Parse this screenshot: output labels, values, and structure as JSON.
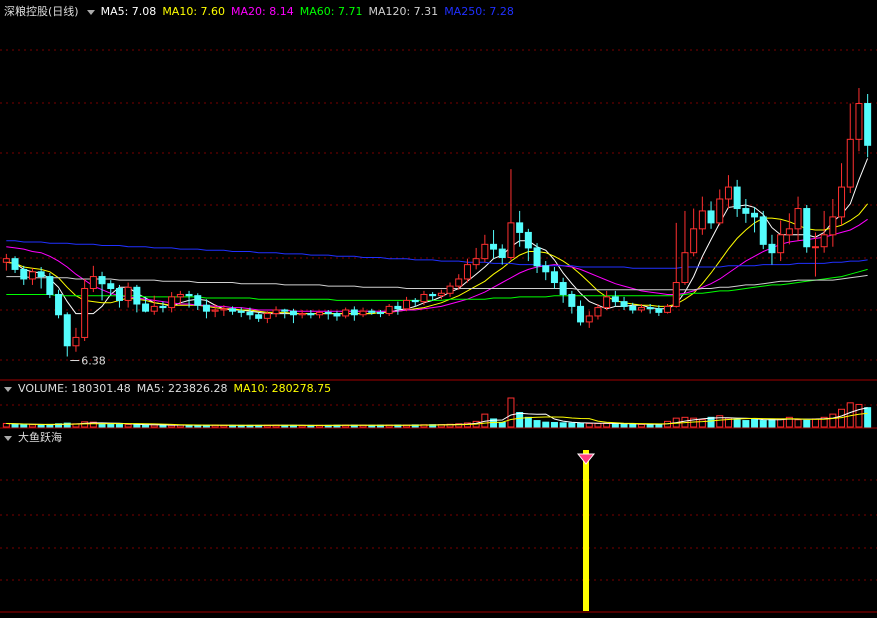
{
  "main_legend": {
    "title": "深粮控股(日线)",
    "items": [
      {
        "label": "MA5: 7.08",
        "color": "#ffffff"
      },
      {
        "label": "MA10: 7.60",
        "color": "#ffff00"
      },
      {
        "label": "MA20: 8.14",
        "color": "#ff00ff"
      },
      {
        "label": "MA60: 7.71",
        "color": "#00ff00"
      },
      {
        "label": "MA120: 7.31",
        "color": "#d0d0d0"
      },
      {
        "label": "MA250: 7.28",
        "color": "#2030ff"
      }
    ]
  },
  "volume_legend": {
    "items": [
      {
        "label": "VOLUME: 180301.48",
        "color": "#dddddd"
      },
      {
        "label": "MA5: 223826.28",
        "color": "#dddddd"
      },
      {
        "label": "MA10: 280278.75",
        "color": "#ffff00"
      }
    ]
  },
  "indicator_legend": {
    "title": "大鱼跃海"
  },
  "min_price_label": "6.38",
  "colors": {
    "up": "#ff3030",
    "down": "#54fcfc",
    "grid": "#7a0000",
    "signal": "#ffff00"
  },
  "chart_data": {
    "type": "candlestick",
    "min_price": 6.38,
    "candles": [
      [
        7.17,
        7.2,
        7.1,
        7.24
      ],
      [
        7.2,
        7.11,
        7.08,
        7.22
      ],
      [
        7.11,
        7.03,
        6.98,
        7.14
      ],
      [
        7.03,
        7.09,
        6.98,
        7.12
      ],
      [
        7.09,
        7.05,
        6.95,
        7.13
      ],
      [
        7.05,
        6.9,
        6.87,
        7.08
      ],
      [
        6.9,
        6.73,
        6.7,
        6.94
      ],
      [
        6.73,
        6.47,
        6.38,
        6.75
      ],
      [
        6.47,
        6.54,
        6.42,
        6.62
      ],
      [
        6.54,
        6.95,
        6.51,
        7.03
      ],
      [
        6.95,
        7.05,
        6.92,
        7.14
      ],
      [
        7.05,
        6.99,
        6.85,
        7.09
      ],
      [
        6.99,
        6.95,
        6.89,
        7.02
      ],
      [
        6.95,
        6.85,
        6.79,
        6.98
      ],
      [
        6.85,
        6.96,
        6.79,
        7.0
      ],
      [
        6.96,
        6.82,
        6.75,
        6.98
      ],
      [
        6.82,
        6.76,
        6.75,
        6.88
      ],
      [
        6.76,
        6.8,
        6.73,
        6.89
      ],
      [
        6.8,
        6.79,
        6.75,
        6.84
      ],
      [
        6.79,
        6.88,
        6.75,
        6.92
      ],
      [
        6.88,
        6.9,
        6.82,
        6.93
      ],
      [
        6.9,
        6.89,
        6.79,
        6.93
      ],
      [
        6.89,
        6.81,
        6.77,
        6.91
      ],
      [
        6.81,
        6.76,
        6.7,
        6.86
      ],
      [
        6.76,
        6.77,
        6.71,
        6.82
      ],
      [
        6.77,
        6.78,
        6.72,
        6.81
      ],
      [
        6.78,
        6.76,
        6.73,
        6.8
      ],
      [
        6.76,
        6.75,
        6.71,
        6.79
      ],
      [
        6.75,
        6.73,
        6.69,
        6.79
      ],
      [
        6.73,
        6.7,
        6.67,
        6.75
      ],
      [
        6.7,
        6.74,
        6.66,
        6.76
      ],
      [
        6.74,
        6.77,
        6.71,
        6.8
      ],
      [
        6.77,
        6.76,
        6.7,
        6.78
      ],
      [
        6.76,
        6.73,
        6.66,
        6.78
      ],
      [
        6.73,
        6.74,
        6.7,
        6.77
      ],
      [
        6.74,
        6.73,
        6.7,
        6.77
      ],
      [
        6.73,
        6.75,
        6.7,
        6.76
      ],
      [
        6.75,
        6.74,
        6.69,
        6.77
      ],
      [
        6.74,
        6.72,
        6.68,
        6.76
      ],
      [
        6.72,
        6.77,
        6.7,
        6.79
      ],
      [
        6.77,
        6.73,
        6.68,
        6.8
      ],
      [
        6.73,
        6.76,
        6.71,
        6.79
      ],
      [
        6.76,
        6.75,
        6.73,
        6.78
      ],
      [
        6.75,
        6.74,
        6.71,
        6.77
      ],
      [
        6.74,
        6.8,
        6.72,
        6.82
      ],
      [
        6.8,
        6.78,
        6.73,
        6.84
      ],
      [
        6.78,
        6.85,
        6.76,
        6.88
      ],
      [
        6.85,
        6.84,
        6.8,
        6.87
      ],
      [
        6.84,
        6.9,
        6.81,
        6.93
      ],
      [
        6.9,
        6.89,
        6.85,
        6.92
      ],
      [
        6.89,
        6.91,
        6.86,
        6.94
      ],
      [
        6.91,
        6.97,
        6.88,
        7.0
      ],
      [
        6.97,
        7.03,
        6.94,
        7.07
      ],
      [
        7.03,
        7.15,
        7.0,
        7.2
      ],
      [
        7.15,
        7.2,
        7.11,
        7.29
      ],
      [
        7.2,
        7.32,
        7.17,
        7.4
      ],
      [
        7.32,
        7.28,
        7.2,
        7.44
      ],
      [
        7.28,
        7.21,
        7.15,
        7.32
      ],
      [
        7.21,
        7.5,
        7.19,
        7.95
      ],
      [
        7.5,
        7.42,
        7.3,
        7.6
      ],
      [
        7.42,
        7.29,
        7.18,
        7.45
      ],
      [
        7.29,
        7.14,
        7.08,
        7.33
      ],
      [
        7.14,
        7.09,
        7.02,
        7.18
      ],
      [
        7.09,
        7.0,
        6.95,
        7.13
      ],
      [
        7.0,
        6.9,
        6.83,
        7.04
      ],
      [
        6.9,
        6.8,
        6.74,
        6.93
      ],
      [
        6.8,
        6.67,
        6.64,
        6.85
      ],
      [
        6.67,
        6.72,
        6.62,
        6.76
      ],
      [
        6.72,
        6.79,
        6.69,
        6.82
      ],
      [
        6.79,
        6.88,
        6.77,
        6.93
      ],
      [
        6.88,
        6.84,
        6.8,
        6.93
      ],
      [
        6.84,
        6.8,
        6.77,
        6.88
      ],
      [
        6.8,
        6.77,
        6.74,
        6.83
      ],
      [
        6.77,
        6.79,
        6.75,
        6.82
      ],
      [
        6.79,
        6.78,
        6.74,
        6.82
      ],
      [
        6.78,
        6.75,
        6.72,
        6.81
      ],
      [
        6.75,
        6.8,
        6.74,
        6.82
      ],
      [
        6.8,
        7.0,
        6.79,
        7.5
      ],
      [
        7.0,
        7.25,
        6.98,
        7.6
      ],
      [
        7.25,
        7.45,
        7.22,
        7.62
      ],
      [
        7.45,
        7.6,
        7.4,
        7.72
      ],
      [
        7.6,
        7.5,
        7.45,
        7.68
      ],
      [
        7.5,
        7.7,
        7.48,
        7.78
      ],
      [
        7.7,
        7.8,
        7.62,
        7.9
      ],
      [
        7.8,
        7.62,
        7.55,
        7.86
      ],
      [
        7.62,
        7.58,
        7.5,
        7.7
      ],
      [
        7.58,
        7.55,
        7.42,
        7.63
      ],
      [
        7.55,
        7.32,
        7.28,
        7.6
      ],
      [
        7.32,
        7.25,
        7.15,
        7.4
      ],
      [
        7.25,
        7.4,
        7.18,
        7.52
      ],
      [
        7.4,
        7.45,
        7.32,
        7.58
      ],
      [
        7.45,
        7.62,
        7.35,
        7.72
      ],
      [
        7.62,
        7.3,
        7.25,
        7.65
      ],
      [
        7.3,
        7.3,
        7.05,
        7.42
      ],
      [
        7.3,
        7.4,
        7.25,
        7.6
      ],
      [
        7.4,
        7.55,
        7.3,
        7.7
      ],
      [
        7.55,
        7.8,
        7.48,
        8.0
      ],
      [
        7.8,
        8.2,
        7.75,
        8.5
      ],
      [
        8.2,
        8.5,
        8.1,
        8.63
      ],
      [
        8.5,
        8.15,
        8.05,
        8.58
      ]
    ],
    "ma": [
      {
        "name": "MA5",
        "values": [
          7.17,
          7.16,
          7.11,
          7.09,
          7.08,
          7.03,
          6.96,
          6.84,
          6.74,
          6.74,
          6.74,
          6.8,
          6.9,
          6.96,
          6.96,
          6.91,
          6.87,
          6.83,
          6.82,
          6.8,
          6.83,
          6.85,
          6.86,
          6.85,
          6.81,
          6.78,
          6.77,
          6.77,
          6.76,
          6.75,
          6.74,
          6.74,
          6.74,
          6.74,
          6.74,
          6.74,
          6.74,
          6.74,
          6.74,
          6.74,
          6.74,
          6.74,
          6.74,
          6.75,
          6.75,
          6.77,
          6.78,
          6.8,
          6.83,
          6.85,
          6.88,
          6.92,
          6.95,
          7.01,
          7.07,
          7.13,
          7.2,
          7.23,
          7.3,
          7.35,
          7.35,
          7.3,
          7.27,
          7.19,
          7.08,
          6.99,
          6.91,
          6.84,
          6.81,
          6.78,
          6.8,
          6.8,
          6.81,
          6.81,
          6.79,
          6.78,
          6.78,
          6.82,
          6.92,
          7.05,
          7.22,
          7.36,
          7.5,
          7.63,
          7.64,
          7.65,
          7.63,
          7.57,
          7.46,
          7.4,
          7.4,
          7.4,
          7.4,
          7.38,
          7.42,
          7.51,
          7.57,
          7.66,
          7.86,
          8.04
        ]
      },
      {
        "name": "MA10",
        "values": [
          7.17,
          7.16,
          7.13,
          7.12,
          7.11,
          7.09,
          7.04,
          6.96,
          6.89,
          6.85,
          6.84,
          6.83,
          6.83,
          6.85,
          6.87,
          6.86,
          6.85,
          6.83,
          6.82,
          6.81,
          6.81,
          6.81,
          6.81,
          6.8,
          6.79,
          6.78,
          6.78,
          6.77,
          6.77,
          6.76,
          6.75,
          6.75,
          6.75,
          6.74,
          6.74,
          6.74,
          6.74,
          6.74,
          6.74,
          6.74,
          6.74,
          6.74,
          6.74,
          6.75,
          6.75,
          6.76,
          6.77,
          6.78,
          6.79,
          6.81,
          6.83,
          6.86,
          6.89,
          6.93,
          6.97,
          7.01,
          7.07,
          7.12,
          7.18,
          7.23,
          7.26,
          7.26,
          7.25,
          7.22,
          7.18,
          7.13,
          7.07,
          7.0,
          6.93,
          6.88,
          6.85,
          6.83,
          6.82,
          6.81,
          6.81,
          6.8,
          6.8,
          6.82,
          6.86,
          6.91,
          6.99,
          7.08,
          7.18,
          7.28,
          7.37,
          7.44,
          7.5,
          7.54,
          7.54,
          7.53,
          7.51,
          7.48,
          7.45,
          7.44,
          7.44,
          7.46,
          7.48,
          7.52,
          7.57,
          7.66
        ]
      },
      {
        "name": "MA20",
        "values": [
          7.3,
          7.29,
          7.28,
          7.26,
          7.25,
          7.22,
          7.18,
          7.13,
          7.07,
          7.02,
          6.97,
          6.94,
          6.91,
          6.89,
          6.88,
          6.87,
          6.86,
          6.85,
          6.84,
          6.83,
          6.82,
          6.82,
          6.81,
          6.81,
          6.8,
          6.8,
          6.79,
          6.79,
          6.78,
          6.77,
          6.77,
          6.77,
          6.77,
          6.76,
          6.76,
          6.76,
          6.76,
          6.76,
          6.76,
          6.76,
          6.76,
          6.76,
          6.76,
          6.76,
          6.76,
          6.76,
          6.77,
          6.77,
          6.78,
          6.79,
          6.8,
          6.82,
          6.84,
          6.86,
          6.89,
          6.92,
          6.96,
          7.0,
          7.04,
          7.08,
          7.11,
          7.13,
          7.14,
          7.15,
          7.14,
          7.13,
          7.11,
          7.08,
          7.05,
          7.02,
          6.99,
          6.97,
          6.95,
          6.93,
          6.92,
          6.91,
          6.9,
          6.9,
          6.91,
          6.93,
          6.96,
          6.99,
          7.03,
          7.08,
          7.13,
          7.18,
          7.22,
          7.26,
          7.29,
          7.32,
          7.34,
          7.35,
          7.36,
          7.37,
          7.38,
          7.4,
          7.42,
          7.44,
          7.48,
          7.53
        ]
      },
      {
        "name": "MA60",
        "values": [
          6.9,
          6.9,
          6.9,
          6.9,
          6.9,
          6.9,
          6.89,
          6.89,
          6.89,
          6.89,
          6.89,
          6.89,
          6.89,
          6.89,
          6.89,
          6.89,
          6.88,
          6.88,
          6.88,
          6.88,
          6.88,
          6.88,
          6.88,
          6.87,
          6.87,
          6.87,
          6.87,
          6.87,
          6.87,
          6.86,
          6.86,
          6.86,
          6.86,
          6.86,
          6.86,
          6.86,
          6.86,
          6.86,
          6.85,
          6.85,
          6.85,
          6.85,
          6.85,
          6.85,
          6.85,
          6.85,
          6.85,
          6.85,
          6.85,
          6.85,
          6.85,
          6.86,
          6.86,
          6.86,
          6.86,
          6.86,
          6.87,
          6.87,
          6.87,
          6.88,
          6.88,
          6.88,
          6.88,
          6.89,
          6.89,
          6.89,
          6.89,
          6.89,
          6.89,
          6.89,
          6.89,
          6.89,
          6.89,
          6.89,
          6.89,
          6.89,
          6.89,
          6.89,
          6.9,
          6.91,
          6.91,
          6.92,
          6.93,
          6.93,
          6.94,
          6.95,
          6.96,
          6.97,
          6.98,
          6.98,
          6.99,
          7.0,
          7.01,
          7.02,
          7.03,
          7.04,
          7.05,
          7.07,
          7.09,
          7.11
        ]
      },
      {
        "name": "MA120",
        "values": [
          7.05,
          7.05,
          7.05,
          7.04,
          7.04,
          7.04,
          7.04,
          7.04,
          7.03,
          7.03,
          7.03,
          7.03,
          7.03,
          7.02,
          7.02,
          7.02,
          7.02,
          7.02,
          7.01,
          7.01,
          7.01,
          7.01,
          7.0,
          7.0,
          7.0,
          7.0,
          7.0,
          6.99,
          6.99,
          6.99,
          6.99,
          6.99,
          6.98,
          6.98,
          6.98,
          6.98,
          6.98,
          6.97,
          6.97,
          6.97,
          6.97,
          6.96,
          6.96,
          6.96,
          6.96,
          6.96,
          6.95,
          6.95,
          6.95,
          6.95,
          6.95,
          6.95,
          6.95,
          6.95,
          6.95,
          6.95,
          6.95,
          6.95,
          6.95,
          6.95,
          6.95,
          6.95,
          6.95,
          6.95,
          6.95,
          6.95,
          6.94,
          6.94,
          6.94,
          6.94,
          6.94,
          6.94,
          6.94,
          6.94,
          6.94,
          6.94,
          6.94,
          6.94,
          6.94,
          6.94,
          6.95,
          6.95,
          6.96,
          6.96,
          6.97,
          6.98,
          6.98,
          6.99,
          7.0,
          7.01,
          7.01,
          7.02,
          7.02,
          7.02,
          7.02,
          7.02,
          7.03,
          7.04,
          7.05,
          7.06
        ]
      },
      {
        "name": "MA250",
        "values": [
          7.35,
          7.35,
          7.34,
          7.34,
          7.34,
          7.33,
          7.33,
          7.33,
          7.32,
          7.32,
          7.32,
          7.31,
          7.31,
          7.31,
          7.3,
          7.3,
          7.3,
          7.29,
          7.29,
          7.29,
          7.28,
          7.28,
          7.28,
          7.27,
          7.27,
          7.27,
          7.26,
          7.26,
          7.26,
          7.25,
          7.25,
          7.25,
          7.24,
          7.24,
          7.24,
          7.23,
          7.23,
          7.23,
          7.22,
          7.22,
          7.22,
          7.21,
          7.21,
          7.21,
          7.2,
          7.2,
          7.2,
          7.19,
          7.19,
          7.19,
          7.18,
          7.18,
          7.18,
          7.17,
          7.17,
          7.17,
          7.16,
          7.16,
          7.16,
          7.15,
          7.15,
          7.15,
          7.14,
          7.14,
          7.14,
          7.14,
          7.13,
          7.13,
          7.13,
          7.13,
          7.13,
          7.13,
          7.12,
          7.12,
          7.12,
          7.12,
          7.12,
          7.12,
          7.13,
          7.13,
          7.13,
          7.13,
          7.13,
          7.14,
          7.14,
          7.14,
          7.14,
          7.15,
          7.15,
          7.15,
          7.15,
          7.16,
          7.16,
          7.16,
          7.16,
          7.17,
          7.17,
          7.18,
          7.18,
          7.19
        ]
      }
    ],
    "volume": [
      22,
      18,
      15,
      14,
      13,
      16,
      20,
      24,
      20,
      32,
      30,
      22,
      18,
      16,
      15,
      14,
      12,
      12,
      11,
      11,
      12,
      12,
      11,
      10,
      11,
      10,
      10,
      10,
      10,
      10,
      11,
      11,
      10,
      10,
      10,
      10,
      10,
      10,
      11,
      11,
      11,
      11,
      10,
      11,
      12,
      12,
      12,
      13,
      14,
      14,
      15,
      17,
      20,
      25,
      35,
      80,
      50,
      28,
      180,
      90,
      60,
      40,
      30,
      28,
      26,
      24,
      24,
      22,
      22,
      22,
      20,
      18,
      17,
      16,
      16,
      16,
      35,
      55,
      60,
      55,
      45,
      60,
      70,
      55,
      45,
      40,
      50,
      40,
      48,
      50,
      60,
      45,
      42,
      50,
      60,
      80,
      110,
      150,
      140,
      120
    ],
    "signal_index": 64
  }
}
